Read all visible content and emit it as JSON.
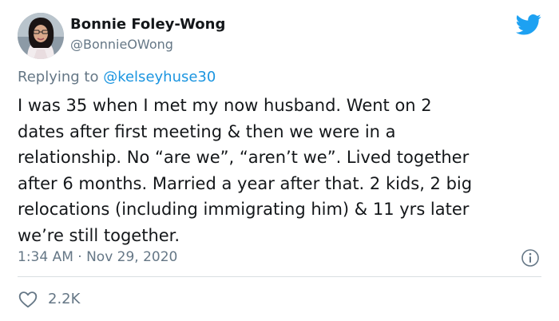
{
  "author": {
    "display_name": "Bonnie Foley-Wong",
    "handle": "@BonnieOWong"
  },
  "reply": {
    "prefix": "Replying to ",
    "mention": "@kelseyhuse30"
  },
  "tweet_lines": [
    "I was 35 when I met my now husband. Went on 2",
    "dates after first meeting & then we were in a",
    "relationship. No “are we”, “aren’t we”. Lived together",
    "after 6 months. Married a year after that. 2 kids, 2 big",
    "relocations (including immigrating him) & 11 yrs later",
    "we’re still together."
  ],
  "meta": {
    "timestamp": "1:34 AM · Nov 29, 2020"
  },
  "engagement": {
    "likes": "2.2K"
  },
  "icons": {
    "brand": "twitter-bird-icon",
    "info": "info-icon",
    "like": "heart-icon"
  },
  "colors": {
    "brand_blue": "#1da1f2",
    "link_blue": "#1b95e0",
    "secondary_text": "#657786",
    "primary_text": "#14171a"
  }
}
